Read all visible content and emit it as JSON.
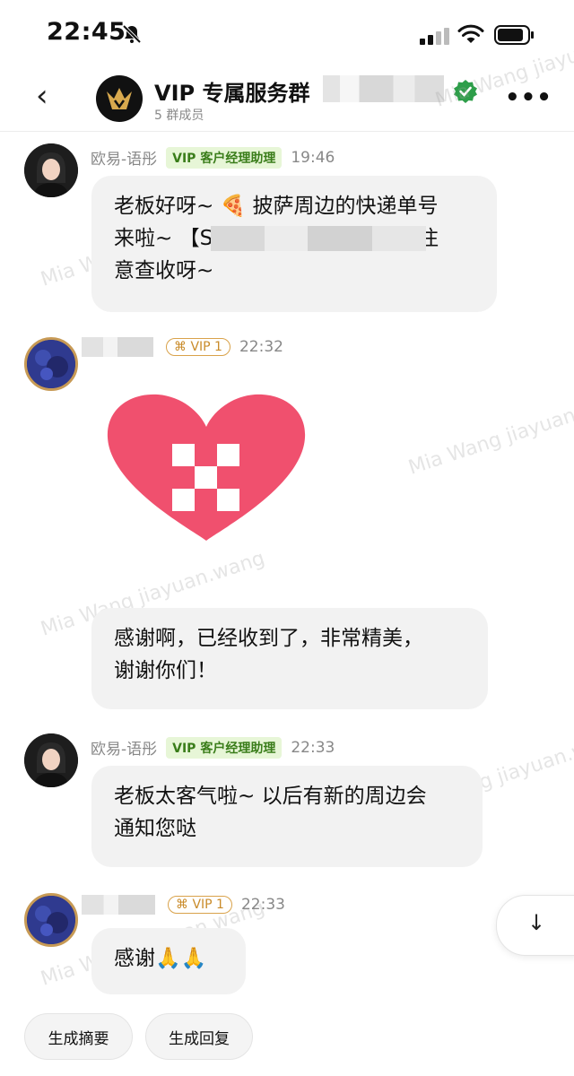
{
  "status_bar": {
    "time": "22:45"
  },
  "header": {
    "back_label": "‹",
    "title": "VIP 专属服务群",
    "subtitle": "5 群成员",
    "more_label": "•••"
  },
  "watermark": "Mia Wang jiayuan.wang",
  "messages": [
    {
      "sender": "欧易-语彤",
      "role": "VIP 客户经理助理",
      "time": "19:46",
      "lines": [
        "老板好呀~ 🍕 披萨周边的快递单号",
        "来啦~ 【S                        】 要注",
        "意查收呀~"
      ]
    },
    {
      "sender": "",
      "badge": "VIP 1",
      "time": "22:32",
      "sticker": "heart-okx-sticker"
    },
    {
      "lines": [
        "感谢啊，已经收到了，非常精美，",
        "谢谢你们！"
      ]
    },
    {
      "sender": "欧易-语彤",
      "role": "VIP 客户经理助理",
      "time": "22:33",
      "lines": [
        "老板太客气啦~ 以后有新的周边会",
        "通知您哒"
      ]
    },
    {
      "sender": "",
      "badge": "VIP 1",
      "time": "22:33",
      "lines": [
        "感谢🙏🙏"
      ]
    }
  ],
  "suggestions": [
    "生成摘要",
    "生成回复"
  ],
  "scroll_down_label": "↓",
  "colors": {
    "heart": "#f0506e",
    "role_bg": "#e7f6d7",
    "role_text": "#3a7d1a",
    "vip_gold": "#d9a24a",
    "verified": "#2e9e4a"
  }
}
